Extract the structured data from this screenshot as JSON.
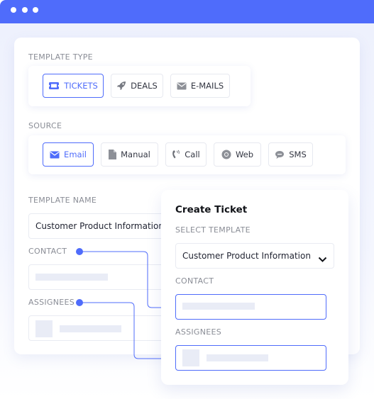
{
  "window": {
    "titlebar_color": "#4f6cfb",
    "controls": [
      "dot-1",
      "dot-2",
      "dot-3"
    ]
  },
  "main_card": {
    "template_type": {
      "label": "TEMPLATE TYPE",
      "options": [
        {
          "label": "TICKETS",
          "icon": "ticket-icon",
          "active": true
        },
        {
          "label": "DEALS",
          "icon": "rocket-icon",
          "active": false
        },
        {
          "label": "E-MAILS",
          "icon": "envelope-icon",
          "active": false
        }
      ]
    },
    "source": {
      "label": "SOURCE",
      "options": [
        {
          "label": "Email",
          "icon": "envelope-icon",
          "active": true
        },
        {
          "label": "Manual",
          "icon": "document-icon",
          "active": false
        },
        {
          "label": "Call",
          "icon": "phone-call-icon",
          "active": false
        },
        {
          "label": "Web",
          "icon": "browser-icon",
          "active": false
        },
        {
          "label": "SMS",
          "icon": "sms-bubble-icon",
          "active": false
        }
      ]
    },
    "template_name": {
      "label": "TEMPLATE NAME",
      "value": "Customer Product Information"
    },
    "contact": {
      "label": "CONTACT"
    },
    "assignees": {
      "label": "ASSIGNEES"
    }
  },
  "create_ticket": {
    "title": "Create Ticket",
    "select_template": {
      "label": "SELECT TEMPLATE",
      "value": "Customer Product Information"
    },
    "contact": {
      "label": "CONTACT"
    },
    "assignees": {
      "label": "ASSIGNEES"
    }
  },
  "colors": {
    "accent": "#4f6cfb",
    "text_muted": "#8a8d96",
    "skeleton": "#e9ecf6"
  }
}
